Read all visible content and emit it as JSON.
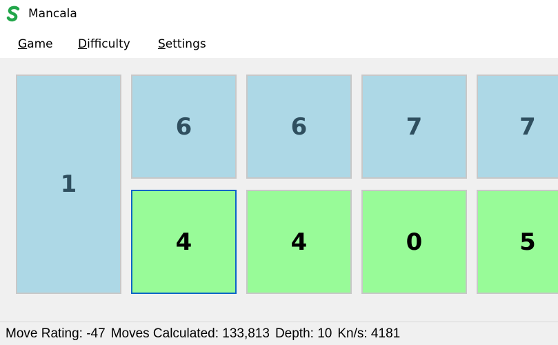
{
  "window": {
    "title": "Mancala",
    "icon": "s-logo-icon",
    "icon_color": "#22a64a"
  },
  "menu": [
    {
      "mnemonic": "G",
      "rest": "ame"
    },
    {
      "mnemonic": "D",
      "rest": "ifficulty"
    },
    {
      "mnemonic": "S",
      "rest": "ettings"
    }
  ],
  "board": {
    "store": "1",
    "opponent_pits": [
      "6",
      "6",
      "7",
      "7"
    ],
    "player_pits": [
      "4",
      "4",
      "0",
      "5"
    ],
    "colors": {
      "opponent": "#add8e6",
      "player": "#98fb98",
      "selected_border": "#0a64c8"
    }
  },
  "status": {
    "move_rating": "Move Rating: -47",
    "moves_calculated": "Moves Calculated: 133,813",
    "depth": "Depth: 10",
    "kns": "Kn/s: 4181"
  }
}
